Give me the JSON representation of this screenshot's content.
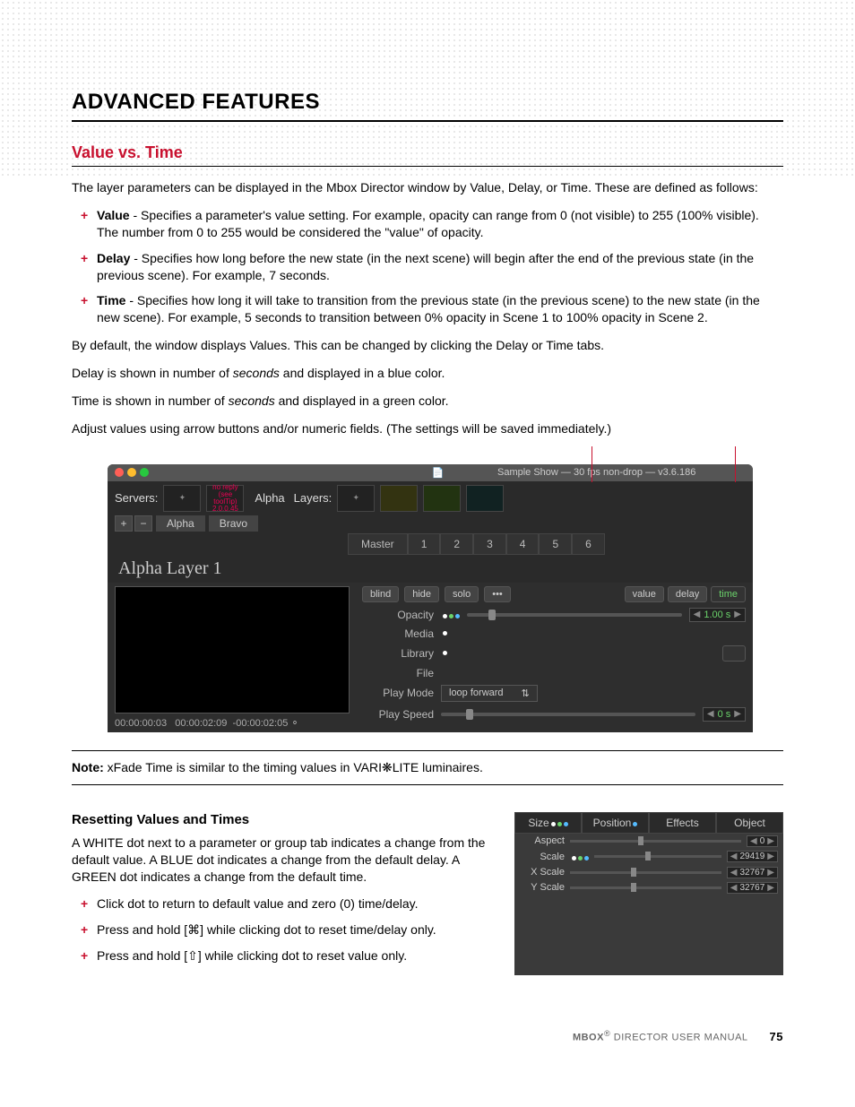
{
  "heading": "ADVANCED FEATURES",
  "subheading": "Value vs. Time",
  "intro": "The layer parameters can be displayed in the Mbox Director window by Value, Delay, or Time. These are defined as follows:",
  "defs": [
    {
      "term": "Value",
      "text": " - Specifies a parameter's value setting. For example, opacity can range from 0 (not visible) to 255 (100% visible). The number from 0 to 255 would be considered the \"value\" of opacity."
    },
    {
      "term": "Delay",
      "text": " - Specifies how long before the new state (in the next scene) will begin after the end of the previous state (in the previous scene). For example, 7 seconds."
    },
    {
      "term": "Time",
      "text": " - Specifies how long it will take to transition from the previous state (in the previous scene) to the new state (in the new scene). For example, 5 seconds to transition between 0% opacity in Scene 1 to 100% opacity in Scene 2."
    }
  ],
  "para1": "By default, the window displays Values. This can be changed by clicking the Delay or Time tabs.",
  "para2a": "Delay is shown in number of ",
  "para2b": "seconds",
  "para2c": " and displayed in a blue color.",
  "para3a": "Time is shown in number of ",
  "para3b": "seconds",
  "para3c": " and displayed in a green color.",
  "para4": "Adjust values using arrow buttons and/or numeric fields. (The settings will be saved immediately.)",
  "screenshot": {
    "title": "Sample Show   —   30 fps non-drop   —   v3.6.186",
    "servers_label": "Servers:",
    "noreply": "no reply\n(see toolTip)\n2.0.0.45",
    "alpha_label": "Alpha",
    "layers_label": "Layers:",
    "tabs": [
      "Alpha",
      "Bravo"
    ],
    "layer_tabs": [
      "Master",
      "1",
      "2",
      "3",
      "4",
      "5",
      "6"
    ],
    "layer_title": "Alpha Layer 1",
    "btns": {
      "blind": "blind",
      "hide": "hide",
      "solo": "solo"
    },
    "vdt": {
      "value": "value",
      "delay": "delay",
      "time": "time"
    },
    "opacity_label": "Opacity",
    "opacity_field": "1.00 s",
    "media_label": "Media",
    "library_label": "Library",
    "file_label": "File",
    "playmode_label": "Play Mode",
    "playmode_value": "loop forward",
    "playspeed_label": "Play Speed",
    "playspeed_field": "0 s",
    "tc1": "00:00:00:03",
    "tc2": "00:00:02:09",
    "tc3": "-00:00:02:05"
  },
  "note_label": "Note:",
  "note_text": "  xFade Time is similar to the timing values in VARI❋LITE luminaires.",
  "reset_heading": "Resetting Values and Times",
  "reset_para": "A WHITE dot next to a parameter or group tab indicates a change from the default value. A BLUE dot indicates a change from the default delay. A GREEN dot indicates a change from the default time.",
  "reset_list": [
    "Click dot to return to default value and zero (0) time/delay.",
    "Press and hold [⌘] while clicking dot to reset time/delay only.",
    "Press and hold [⇧] while clicking dot to reset value only."
  ],
  "fig2": {
    "tabs": [
      "Size",
      "Position",
      "Effects",
      "Object"
    ],
    "rows": [
      {
        "label": "Aspect",
        "val": "0"
      },
      {
        "label": "Scale",
        "val": "29419"
      },
      {
        "label": "X Scale",
        "val": "32767"
      },
      {
        "label": "Y Scale",
        "val": "32767"
      }
    ]
  },
  "footer_product": "MBOX",
  "footer_reg": "®",
  "footer_title": " DIRECTOR USER MANUAL",
  "page_number": "75"
}
